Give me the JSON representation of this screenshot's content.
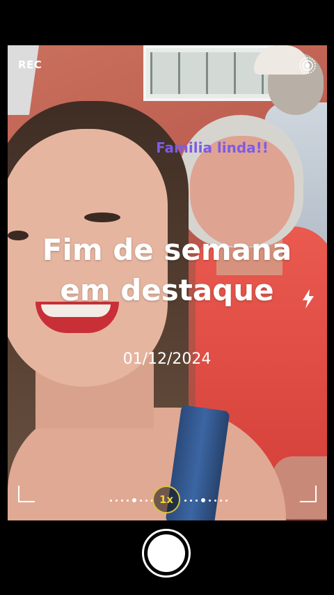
{
  "status": {
    "rec_label": "REC"
  },
  "overlay": {
    "tag": "Familia linda!!",
    "headline_line1": "Fim de semana",
    "headline_line2": "em destaque",
    "date": "01/12/2024"
  },
  "controls": {
    "zoom_label": "1x"
  },
  "icons": [
    "live-photo-icon",
    "flash-icon",
    "shutter-button"
  ],
  "colors": {
    "tag": "#7c5ce6",
    "zoom_ring": "#d9c33a",
    "background": "#000000"
  }
}
